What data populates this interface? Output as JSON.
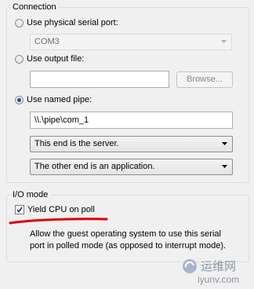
{
  "connection": {
    "title": "Connection",
    "physical_serial_port": {
      "label": "Use physical serial port:",
      "selected_value": "COM3",
      "checked": false
    },
    "output_file": {
      "label": "Use output file:",
      "value": "",
      "browse_label": "Browse...",
      "checked": false
    },
    "named_pipe": {
      "label": "Use named pipe:",
      "checked": true,
      "path": "\\\\.\\pipe\\com_1",
      "end_select": "This end is the server.",
      "other_end_select": "The other end is an application."
    }
  },
  "io_mode": {
    "title": "I/O mode",
    "yield_cpu": {
      "label": "Yield CPU on poll",
      "checked": true
    },
    "description_line1": "Allow the guest operating system to use this serial",
    "description_line2": "port in polled mode (as opposed to interrupt mode)."
  },
  "watermark": {
    "text_cn": "运维网",
    "text_url": "iyunv.com"
  },
  "colors": {
    "annotation_underline": "#e00000",
    "radio_dot": "#1f4f8a"
  }
}
